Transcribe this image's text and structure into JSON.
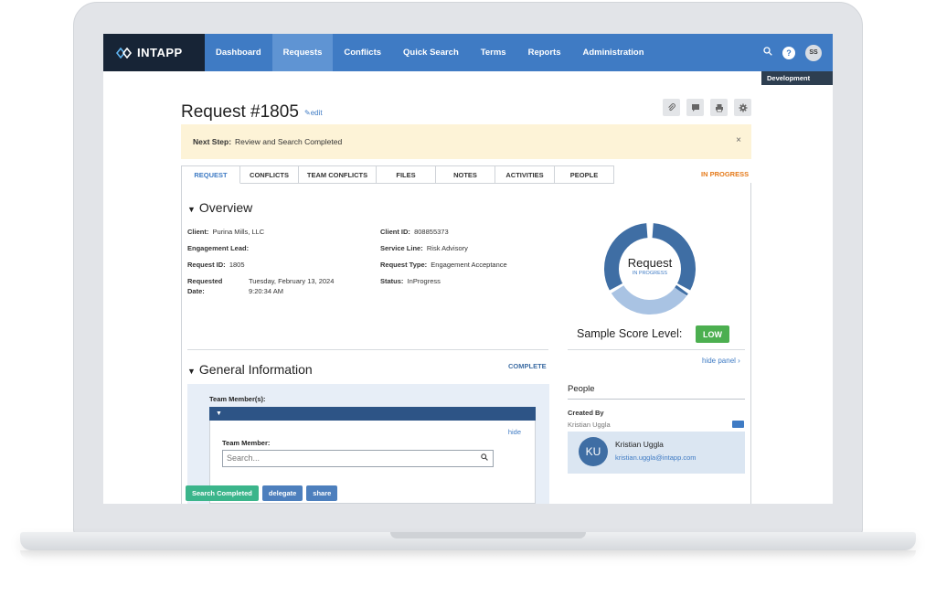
{
  "app": {
    "logo_text": "INTAPP",
    "environment": "Development"
  },
  "nav": {
    "items": [
      {
        "label": "Dashboard"
      },
      {
        "label": "Requests"
      },
      {
        "label": "Conflicts"
      },
      {
        "label": "Quick Search"
      },
      {
        "label": "Terms"
      },
      {
        "label": "Reports"
      },
      {
        "label": "Administration"
      }
    ],
    "active": "Requests",
    "help_glyph": "?",
    "user_initials": "SS",
    "icons": [
      "search-icon",
      "help-icon",
      "user-avatar"
    ]
  },
  "header": {
    "title": "Request #1805",
    "edit_label": "edit",
    "toolbar_icons": [
      "paperclip-icon",
      "comment-icon",
      "print-icon",
      "gear-icon"
    ]
  },
  "next_step": {
    "label": "Next Step:",
    "text": "Review and Search Completed",
    "close_glyph": "×"
  },
  "tabs": [
    {
      "label": "REQUEST"
    },
    {
      "label": "CONFLICTS"
    },
    {
      "label": "TEAM CONFLICTS"
    },
    {
      "label": "FILES"
    },
    {
      "label": "NOTES"
    },
    {
      "label": "ACTIVITIES"
    },
    {
      "label": "PEOPLE"
    }
  ],
  "status": "IN PROGRESS",
  "overview": {
    "title": "Overview",
    "fields_left": [
      {
        "label": "Client:",
        "value": "Purina Mills, LLC"
      },
      {
        "label": "Engagement Lead:",
        "value": ""
      },
      {
        "label": "Request ID:",
        "value": "1805"
      },
      {
        "label": "Requested Date:",
        "value": "Tuesday, February 13, 2024 9:20:34 AM"
      }
    ],
    "fields_right": [
      {
        "label": "Client ID:",
        "value": "808855373"
      },
      {
        "label": "Service Line:",
        "value": "Risk Advisory"
      },
      {
        "label": "Request Type:",
        "value": "Engagement Acceptance"
      },
      {
        "label": "Status:",
        "value": "InProgress"
      }
    ],
    "requested_label_1": "Requested",
    "requested_label_2": "Date:",
    "requested_value_1": "Tuesday, February 13, 2024",
    "requested_value_2": "9:20:34 AM"
  },
  "donut": {
    "label": "Request",
    "sublabel": "IN PROGRESS",
    "progress_fraction": 0.68,
    "color_done": "#3f6ea4",
    "color_remaining": "#a9c3e3"
  },
  "score": {
    "label": "Sample Score Level:",
    "value": "LOW",
    "color": "#4caf50"
  },
  "side_panel": {
    "hide_label": "hide panel",
    "people_title": "People",
    "created_by_label": "Created By",
    "created_by_name": "Kristian Uggla",
    "person": {
      "initials": "KU",
      "name": "Kristian Uggla",
      "email": "kristian.uggla@intapp.com"
    }
  },
  "general_info": {
    "title": "General Information",
    "status": "COMPLETE",
    "team_members_label": "Team Member(s):",
    "hide_label": "hide",
    "team_member_label": "Team Member:",
    "search_placeholder": "Search..."
  },
  "actions": {
    "search_completed": "Search Completed",
    "delegate": "delegate",
    "share": "share"
  }
}
